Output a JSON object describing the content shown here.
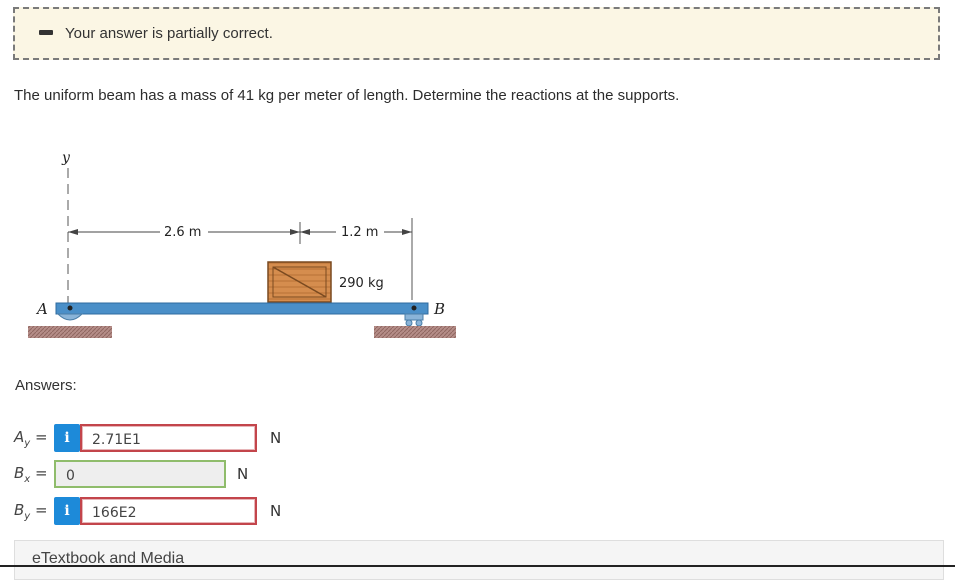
{
  "status": {
    "message": "Your answer is partially correct."
  },
  "question": {
    "text": "The uniform beam has a mass of 41 kg per meter of length. Determine the reactions at the supports."
  },
  "figure": {
    "axis_label": "y",
    "dim_1": "2.6 m",
    "dim_2": "1.2 m",
    "mass_label": "290 kg",
    "support_a": "A",
    "support_b": "B"
  },
  "answers": {
    "title": "Answers:",
    "rows": [
      {
        "var": "A",
        "sub": "y",
        "value": "2.71E1",
        "unit": "N",
        "status": "incorrect",
        "has_info": true
      },
      {
        "var": "B",
        "sub": "x",
        "value": "0",
        "unit": "N",
        "status": "correct",
        "has_info": false
      },
      {
        "var": "B",
        "sub": "y",
        "value": "166E2",
        "unit": "N",
        "status": "incorrect",
        "has_info": true
      }
    ],
    "info_glyph": "i"
  },
  "etextbook": {
    "label": "eTextbook and Media"
  },
  "colors": {
    "info_button": "#1d8ad9",
    "incorrect_border": "#c3454b",
    "correct_border": "#8fbc6b",
    "banner_bg": "#fbf6e4",
    "beam": "#4a8fc8"
  }
}
